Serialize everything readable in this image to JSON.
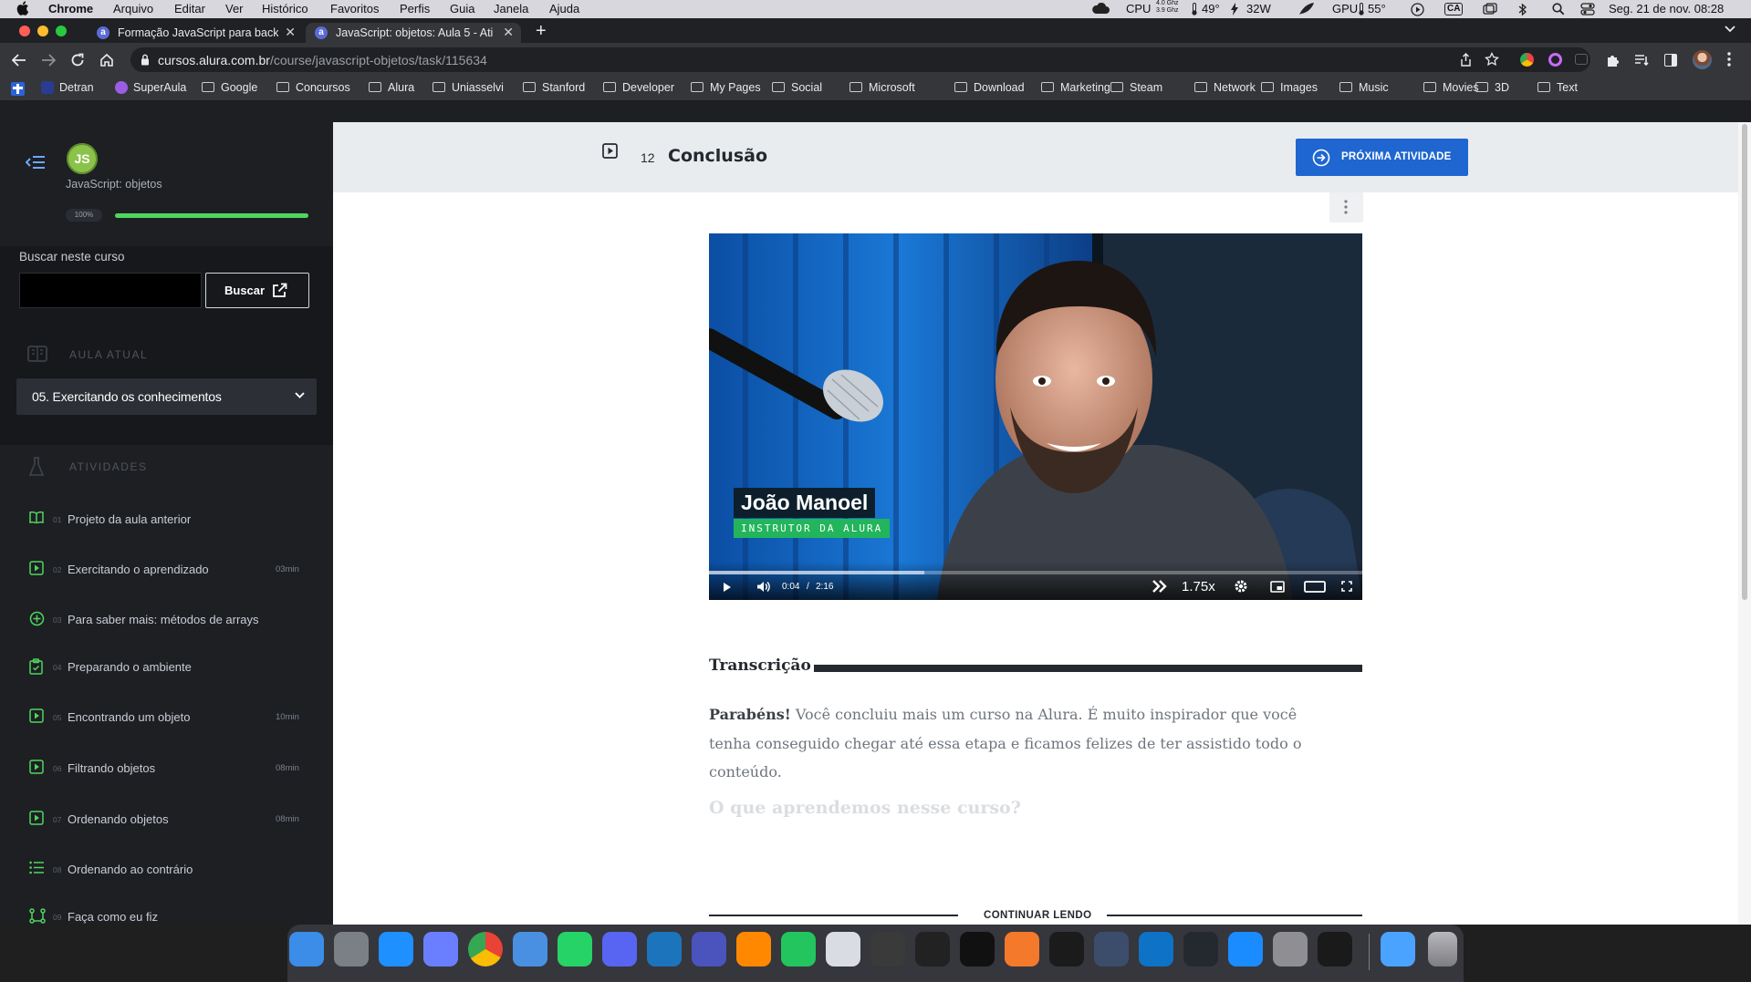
{
  "menubar": {
    "app": "Chrome",
    "items": [
      "Arquivo",
      "Editar",
      "Ver",
      "Histórico",
      "Favoritos",
      "Perfis",
      "Guia",
      "Janela",
      "Ajuda"
    ],
    "cpu_label": "CPU",
    "cpu_freq1": "4.0 Ghz",
    "cpu_freq2": "3.9 Ghz",
    "cpu_temp": "49°",
    "power": "32W",
    "gpu_label": "GPU",
    "gpu_temp": "55°",
    "input_source": "CA",
    "datetime": "Seg. 21 de nov.  08:28"
  },
  "tabs": [
    {
      "favicon": "a",
      "title": "Formação JavaScript para back-end",
      "active": false
    },
    {
      "favicon": "a",
      "title": "JavaScript: objetos: Aula 5 - Ati",
      "active": true
    }
  ],
  "address": {
    "host": "cursos.alura.com.br",
    "path": "/course/javascript-objetos/task/115634"
  },
  "bookmarks": [
    "Detran",
    "SuperAula",
    "Google",
    "Concursos",
    "Alura",
    "Uniasselvi",
    "Stanford",
    "Developer",
    "My Pages",
    "Social",
    "Microsoft",
    "Download",
    "Marketing",
    "Steam",
    "Network",
    "Images",
    "Music",
    "Movies",
    "3D",
    "Text"
  ],
  "sidebar": {
    "course_logo": "JS",
    "course_name": "JavaScript: objetos",
    "progress_label": "100%",
    "progress_fraction": 1.0,
    "search_label": "Buscar neste curso",
    "search_value": "",
    "search_button": "Buscar",
    "current_lesson_heading": "AULA ATUAL",
    "current_lesson": "05. Exercitando os conhecimentos",
    "activities_heading": "ATIVIDADES",
    "activities": [
      {
        "num": "01",
        "label": "Projeto da aula anterior",
        "duration": "",
        "icon": "book-icon"
      },
      {
        "num": "02",
        "label": "Exercitando o aprendizado",
        "duration": "03min",
        "icon": "video-icon"
      },
      {
        "num": "03",
        "label": "Para saber mais: métodos de arrays",
        "duration": "",
        "icon": "plus-circle-icon"
      },
      {
        "num": "04",
        "label": "Preparando o ambiente",
        "duration": "",
        "icon": "clipboard-icon"
      },
      {
        "num": "05",
        "label": "Encontrando um objeto",
        "duration": "10min",
        "icon": "video-icon"
      },
      {
        "num": "06",
        "label": "Filtrando objetos",
        "duration": "08min",
        "icon": "video-icon"
      },
      {
        "num": "07",
        "label": "Ordenando objetos",
        "duration": "08min",
        "icon": "video-icon"
      },
      {
        "num": "08",
        "label": "Ordenando ao contrário",
        "duration": "",
        "icon": "list-icon"
      },
      {
        "num": "09",
        "label": "Faça como eu fiz",
        "duration": "",
        "icon": "flow-icon"
      }
    ]
  },
  "task": {
    "number": "12",
    "title": "Conclusão",
    "next_button": "PRÓXIMA ATIVIDADE"
  },
  "video": {
    "presenter_name": "João Manoel",
    "presenter_role": "INSTRUTOR DA ALURA",
    "current_time": "0:04",
    "separator": "/",
    "duration": "2:16",
    "speed": "1.75x",
    "progress_fraction": 0.33
  },
  "transcript": {
    "heading": "Transcrição",
    "bold_intro": "Parabéns!",
    "paragraph": " Você concluiu mais um curso na Alura. É muito inspirador que você tenha conseguido chegar até essa etapa e ficamos felizes de ter assistido todo o conteúdo.",
    "subheading": "O que aprendemos nesse curso?",
    "continue": "CONTINUAR LENDO"
  },
  "colors": {
    "accent_blue": "#1f66d1",
    "accent_green": "#4fd65f",
    "sidebar_bg": "#1d1f23",
    "name_tag_bg": "#0d1f2c",
    "role_tag_bg": "#22b55b"
  },
  "dock_apps": [
    "finder-icon",
    "launchpad-icon",
    "safari-icon",
    "vpn-icon",
    "chrome-icon",
    "mail-icon",
    "whatsapp-icon",
    "discord-icon",
    "telegram-icon",
    "teams-icon",
    "vlc-icon",
    "phone-icon",
    "xcode-icon",
    "gimp-icon",
    "inkscape-icon",
    "vectornator-icon",
    "blender-icon",
    "resolve-icon",
    "fusion-icon",
    "vscode-icon",
    "github-icon",
    "appstore-icon",
    "settings-icon",
    "terminal-icon",
    "downloads-icon",
    "trash-icon"
  ]
}
